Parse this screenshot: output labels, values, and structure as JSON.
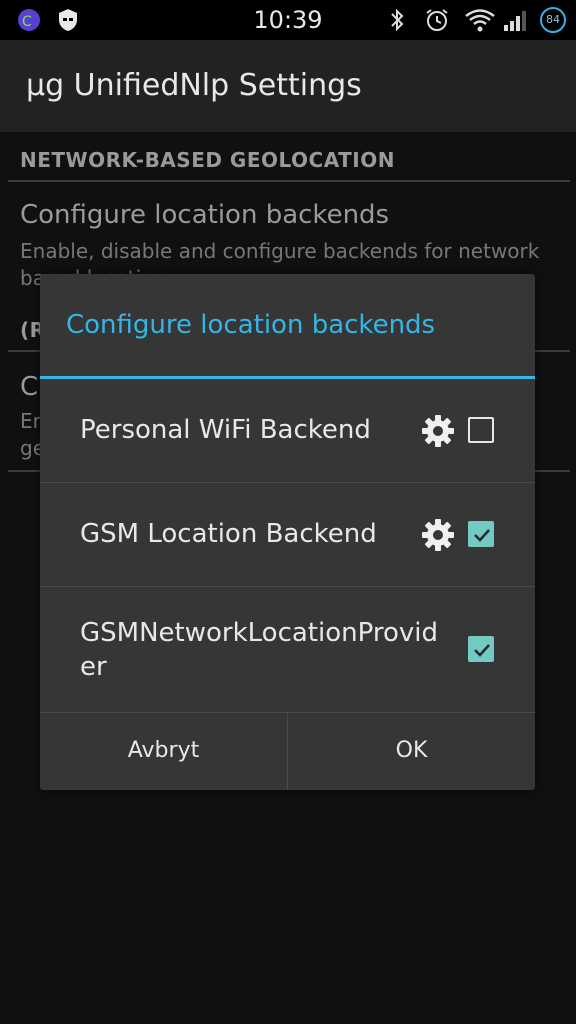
{
  "status_bar": {
    "time": "10:39",
    "battery_level": "84",
    "icons": [
      "app-notification-icon",
      "shield-icon",
      "bluetooth-icon",
      "alarm-icon",
      "wifi-icon",
      "signal-icon",
      "battery-icon"
    ]
  },
  "app_bar": {
    "title": "µg UnifiedNlp Settings"
  },
  "settings": {
    "category_1": "NETWORK-BASED GEOLOCATION",
    "item_1_title": "Configure location backends",
    "item_1_summary": "Enable, disable and configure backends for network based location",
    "category_2": "(R",
    "item_2_title": "C",
    "item_2_summary": "En ge"
  },
  "dialog": {
    "title": "Configure location backends",
    "backends": [
      {
        "label": "Personal WiFi Backend",
        "has_settings": true,
        "checked": false
      },
      {
        "label": "GSM Location Backend",
        "has_settings": true,
        "checked": true
      },
      {
        "label": "GSMNetworkLocationProvider",
        "has_settings": false,
        "checked": true
      }
    ],
    "cancel_label": "Avbryt",
    "ok_label": "OK"
  },
  "colors": {
    "accent": "#33b5e5",
    "checkbox_checked": "#72cac3"
  }
}
